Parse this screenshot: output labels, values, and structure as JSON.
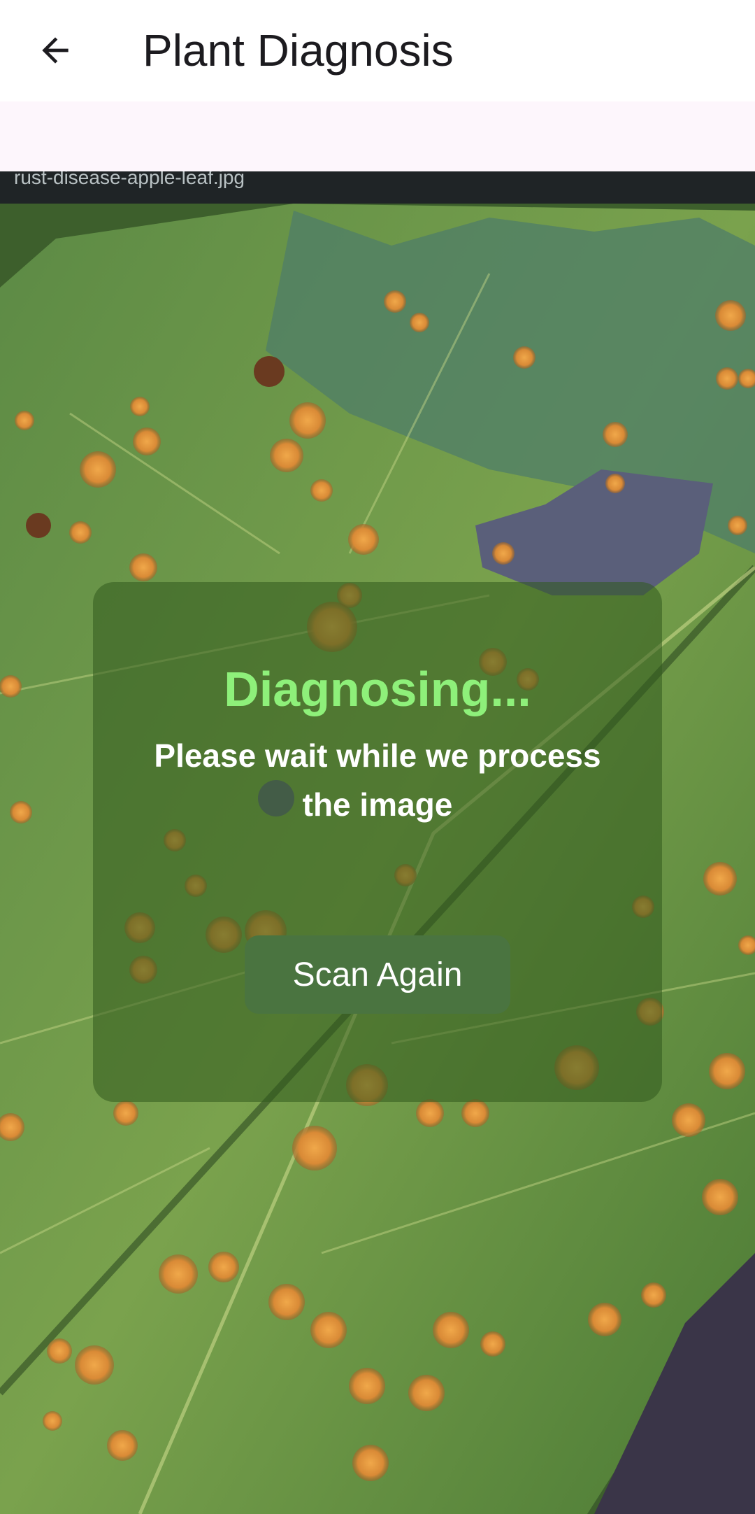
{
  "app_bar": {
    "title": "Plant Diagnosis",
    "back_icon": "arrow-back-icon"
  },
  "photo": {
    "caption": "rust-disease-apple-leaf.jpg"
  },
  "status": {
    "title": "Diagnosing...",
    "message": "Please wait while we process the image",
    "scan_again_label": "Scan Again"
  },
  "colors": {
    "status_title": "#8ef07a",
    "button_bg": "#4a7440",
    "card_bg": "rgba(50, 90, 30, 0.55)"
  }
}
